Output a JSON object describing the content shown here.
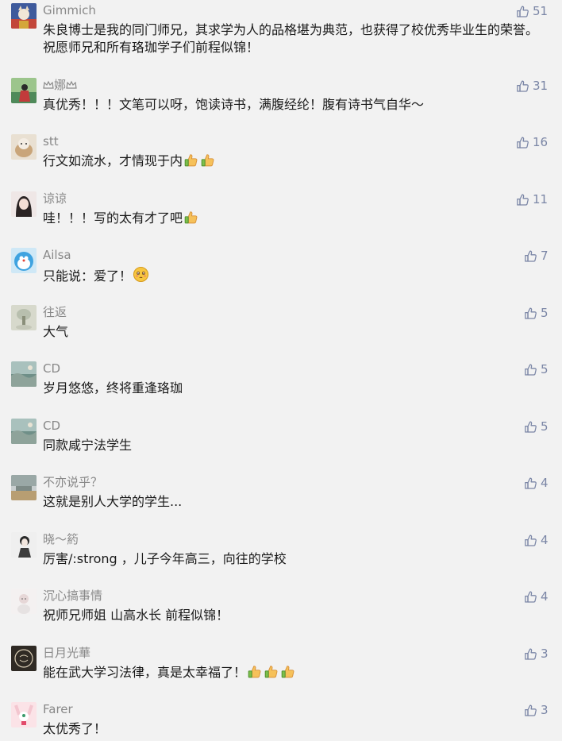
{
  "comments": [
    {
      "name": "Gimmich",
      "text": "朱良博士是我的同门师兄，其求学为人的品格堪为典范，也获得了校优秀毕业生的荣誉。祝愿师兄和所有珞珈学子们前程似锦！",
      "likes": "51",
      "avatar_color": "#3e5a9c"
    },
    {
      "name": "娜",
      "text": "真优秀！！！文笔可以呀，饱读诗书，满腹经纶！腹有诗书气自华～",
      "likes": "31",
      "avatar_color": "#4f8a5a"
    },
    {
      "name": "stt",
      "text": "行文如流水，才情现于内",
      "likes": "16",
      "avatar_color": "#c9a57a"
    },
    {
      "name": "谅谅",
      "text": "哇！！！写的太有才了吧",
      "likes": "11",
      "avatar_color": "#e8d6d2"
    },
    {
      "name": "Ailsa",
      "text": "只能说：爱了！",
      "likes": "7",
      "avatar_color": "#6fb8e0"
    },
    {
      "name": "往返",
      "text": "大气",
      "likes": "5",
      "avatar_color": "#b8bfae"
    },
    {
      "name": "CD",
      "text": "岁月悠悠，终将重逢珞珈",
      "likes": "5",
      "avatar_color": "#8ea39a"
    },
    {
      "name": "CD",
      "text": "同款咸宁法学生",
      "likes": "5",
      "avatar_color": "#8ea39a"
    },
    {
      "name": "不亦说乎？",
      "text": "这就是别人大学的学生...",
      "likes": "4",
      "avatar_color": "#9aa8a6"
    },
    {
      "name": "晓～箹",
      "text": "厉害/:strong ，儿子今年高三，向往的学校",
      "likes": "4",
      "avatar_color": "#d9d9d9"
    },
    {
      "name": "沉心搞事情",
      "text": "祝师兄师姐 山高水长 前程似锦！",
      "likes": "4",
      "avatar_color": "#e6e2e2"
    },
    {
      "name": "日月光華",
      "text": "能在武大学习法律，真是太幸福了！",
      "likes": "3",
      "avatar_color": "#2f2a24"
    },
    {
      "name": "Farer",
      "text": "太优秀了！",
      "likes": "3",
      "avatar_color": "#f3c6cf"
    }
  ],
  "icons": {
    "like": "thumbs-up-icon",
    "emoji_thumb": "thumbs-up-emoji",
    "emoji_blush": "blushing-face-emoji",
    "crown": "crown-icon"
  },
  "colors": {
    "background": "#f2f2f2",
    "name": "#888888",
    "text": "#1a1a1a",
    "like": "#7b86a6"
  }
}
